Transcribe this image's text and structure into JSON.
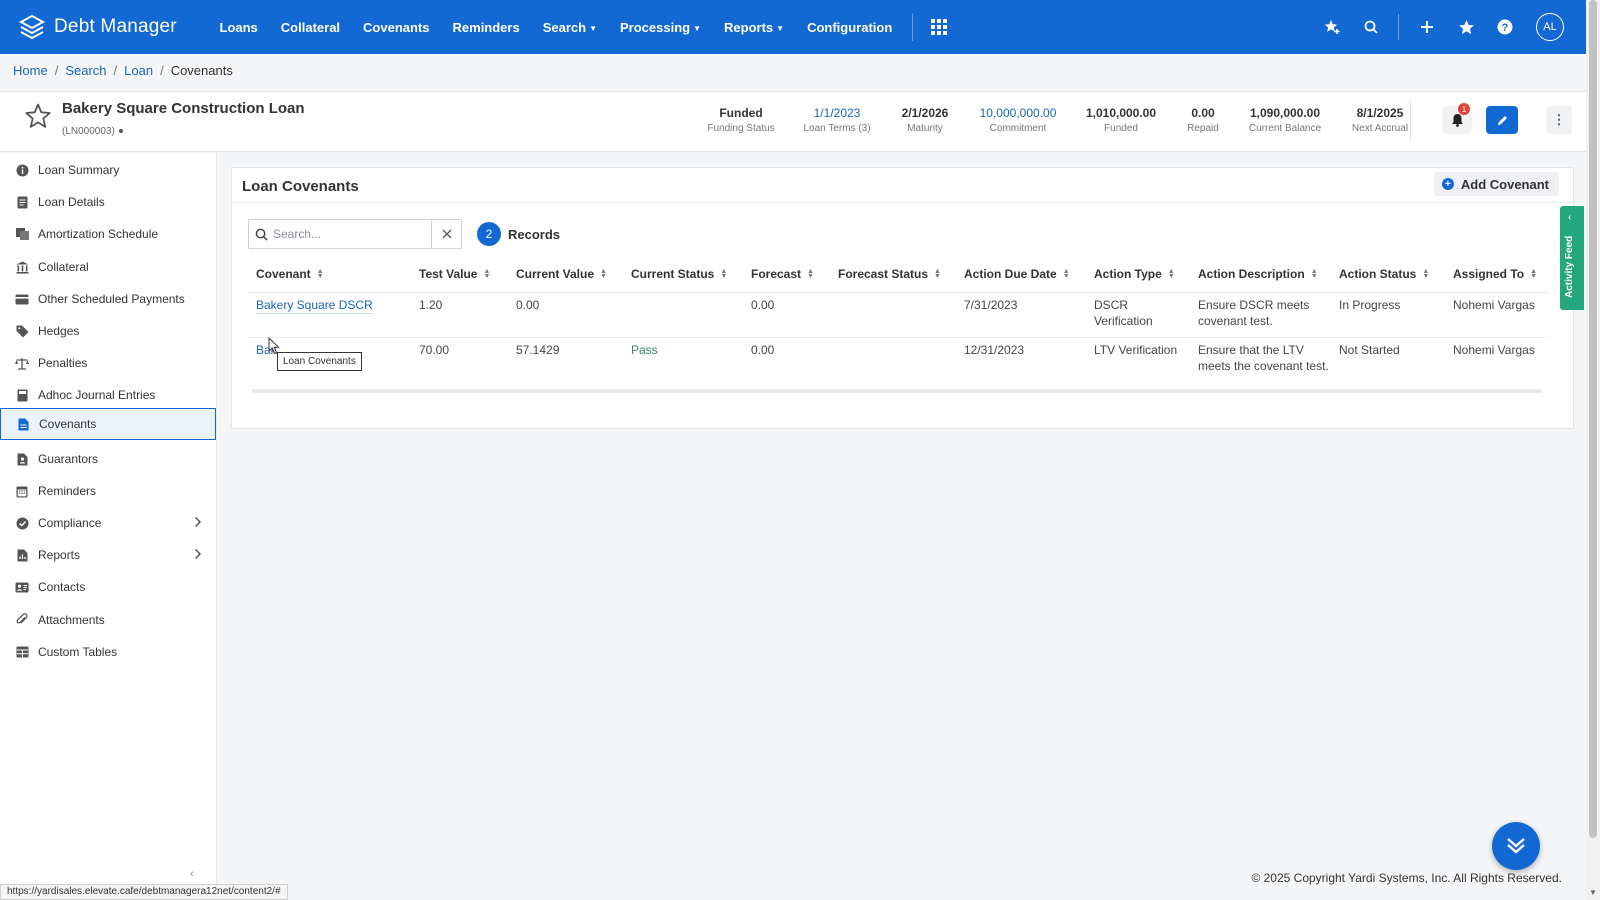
{
  "app": {
    "name": "Debt Manager"
  },
  "nav": {
    "items": [
      {
        "label": "Loans",
        "caret": false
      },
      {
        "label": "Collateral",
        "caret": false
      },
      {
        "label": "Covenants",
        "caret": false
      },
      {
        "label": "Reminders",
        "caret": false
      },
      {
        "label": "Search",
        "caret": true
      },
      {
        "label": "Processing",
        "caret": true
      },
      {
        "label": "Reports",
        "caret": true
      },
      {
        "label": "Configuration",
        "caret": false
      }
    ],
    "user_initials": "AL"
  },
  "breadcrumb": {
    "home": "Home",
    "search": "Search",
    "loan": "Loan",
    "current": "Covenants"
  },
  "loan": {
    "title": "Bakery Square Construction Loan",
    "id": "(LN000003)",
    "notification_count": "1",
    "stats": [
      {
        "value": "Funded",
        "label": "Funding Status",
        "link": false
      },
      {
        "value": "1/1/2023",
        "label": "Loan Terms (3)",
        "link": true
      },
      {
        "value": "2/1/2026",
        "label": "Maturity",
        "link": false
      },
      {
        "value": "10,000,000.00",
        "label": "Commitment",
        "link": true
      },
      {
        "value": "1,010,000.00",
        "label": "Funded",
        "link": false
      },
      {
        "value": "0.00",
        "label": "Repaid",
        "link": false
      },
      {
        "value": "1,090,000.00",
        "label": "Current Balance",
        "link": false
      },
      {
        "value": "8/1/2025",
        "label": "Next Accrual",
        "link": false
      }
    ]
  },
  "sidebar": {
    "items": [
      {
        "label": "Loan Summary",
        "icon": "info-icon"
      },
      {
        "label": "Loan Details",
        "icon": "document-icon"
      },
      {
        "label": "Amortization Schedule",
        "icon": "schedule-icon"
      },
      {
        "label": "Collateral",
        "icon": "bank-icon"
      },
      {
        "label": "Other Scheduled Payments",
        "icon": "payments-icon"
      },
      {
        "label": "Hedges",
        "icon": "tag-icon"
      },
      {
        "label": "Penalties",
        "icon": "scale-icon"
      },
      {
        "label": "Adhoc Journal Entries",
        "icon": "journal-icon"
      },
      {
        "label": "Covenants",
        "icon": "covenant-icon",
        "active": true
      },
      {
        "label": "Guarantors",
        "icon": "guarantor-icon"
      },
      {
        "label": "Reminders",
        "icon": "calendar-icon"
      },
      {
        "label": "Compliance",
        "icon": "check-circle-icon",
        "expandable": true
      },
      {
        "label": "Reports",
        "icon": "report-icon",
        "expandable": true
      },
      {
        "label": "Contacts",
        "icon": "contacts-icon"
      },
      {
        "label": "Attachments",
        "icon": "paperclip-icon"
      },
      {
        "label": "Custom Tables",
        "icon": "table-icon"
      }
    ]
  },
  "covenants": {
    "title": "Loan Covenants",
    "add_label": "Add Covenant",
    "search_placeholder": "Search...",
    "record_count": "2",
    "records_label": "Records",
    "columns": [
      "Covenant",
      "Test Value",
      "Current Value",
      "Current Status",
      "Forecast",
      "Forecast Status",
      "Action Due Date",
      "Action Type",
      "Action Description",
      "Action Status",
      "Assigned To"
    ],
    "rows": [
      {
        "covenant": "Bakery Square DSCR",
        "test_value": "1.20",
        "current_value": "0.00",
        "current_status": "",
        "forecast": "0.00",
        "forecast_status": "",
        "action_due_date": "7/31/2023",
        "action_type_1": "DSCR",
        "action_type_2": "Verification",
        "action_desc_1": "Ensure DSCR meets",
        "action_desc_2": "covenant test.",
        "action_status": "In Progress",
        "assigned_to": "Nohemi Vargas"
      },
      {
        "covenant": "Bak",
        "test_value": "70.00",
        "current_value": "57.1429",
        "current_status": "Pass",
        "forecast": "0.00",
        "forecast_status": "",
        "action_due_date": "12/31/2023",
        "action_type_1": "LTV Verification",
        "action_type_2": "",
        "action_desc_1": "Ensure that the LTV",
        "action_desc_2": "meets the covenant test.",
        "action_status": "Not Started",
        "assigned_to": "Nohemi Vargas"
      }
    ],
    "tooltip": "Loan Covenants"
  },
  "activity_feed": {
    "label": "Activity Feed"
  },
  "footer": {
    "copyright": "© 2025 Copyright Yardi Systems, Inc. All Rights Reserved.",
    "status_url": "https://yardisales.elevate.cafe/debtmanagera12net/content2/#"
  },
  "colors": {
    "primary": "#1269d3",
    "link": "#1a66b8",
    "pass": "#2d8a63",
    "activity": "#24a77d"
  }
}
